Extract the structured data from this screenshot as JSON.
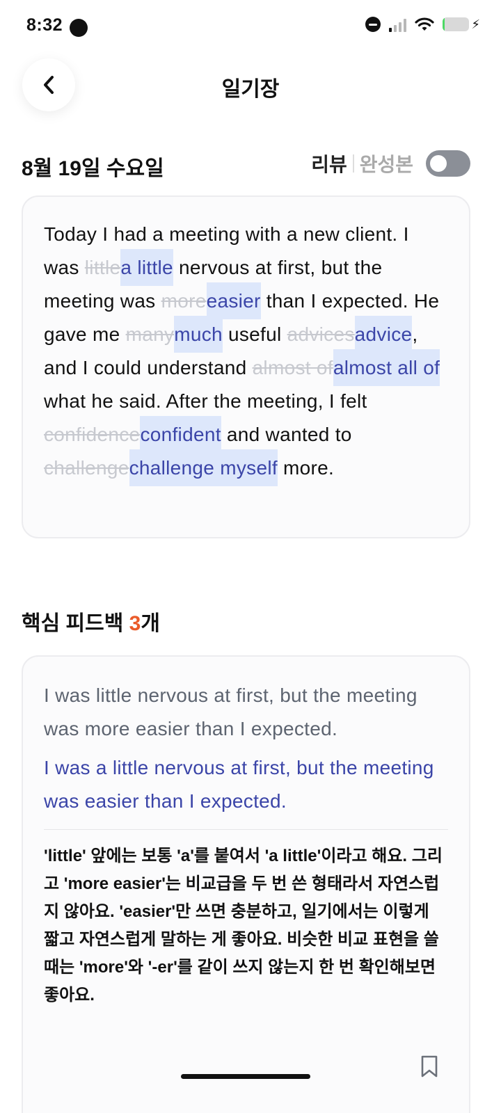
{
  "status_bar": {
    "time": "8:32",
    "icons": [
      "camera-dot",
      "do-not-disturb-icon",
      "signal-icon",
      "wifi-icon",
      "battery-icon",
      "charging-icon"
    ],
    "battery_level": 0.08,
    "battery_color": "#4cd964"
  },
  "header": {
    "back_icon": "chevron-left-icon",
    "title": "일기장"
  },
  "diary": {
    "date": "8월 19일 수요일",
    "mode_review": "리뷰",
    "mode_final": "완성본",
    "toggle_on": false,
    "segments": [
      {
        "t": "Today I had a meeting with a new client. I was "
      },
      {
        "del": "little"
      },
      {
        "ins": "a little"
      },
      {
        "t": " nervous at first, but the meeting was "
      },
      {
        "del": "more"
      },
      {
        "ins": "easier"
      },
      {
        "t": " than I expected. He gave me "
      },
      {
        "del": "many"
      },
      {
        "ins": "much"
      },
      {
        "t": " useful "
      },
      {
        "del": "advices"
      },
      {
        "ins": "advice"
      },
      {
        "t": ", and I could understand "
      },
      {
        "del": "almost of"
      },
      {
        "ins": "almost all of"
      },
      {
        "t": " what he said. After the meeting, I felt "
      },
      {
        "del": "confidence"
      },
      {
        "ins": "confident"
      },
      {
        "t": " and wanted to "
      },
      {
        "del": "challenge"
      },
      {
        "ins": "challenge myself"
      },
      {
        "t": " more."
      }
    ],
    "colors": {
      "inserted_text": "#3b45a8",
      "inserted_bg": "#dde7fb",
      "deleted_text": "#c7c9cf"
    }
  },
  "feedback": {
    "title": "핵심 피드백 ",
    "count": "3",
    "count_suffix": "개",
    "count_color": "#ea5b2a",
    "items": [
      {
        "original": "I was little nervous at first, but the meeting was more easier than I expected.",
        "corrected": "I was a little nervous at first, but the meeting was easier than I expected.",
        "explanation": "'little' 앞에는 보통 'a'를 붙여서 'a little'이라고 해요. 그리고 'more easier'는 비교급을 두 번 쓴 형태라서 자연스럽지 않아요. 'easier'만 쓰면 충분하고, 일기에서는 이렇게 짧고 자연스럽게 말하는 게 좋아요. 비슷한 비교 표현을 쓸 때는 'more'와 '-er'를 같이 쓰지 않는지 한 번 확인해보면 좋아요.",
        "bookmark_icon": "bookmark-icon"
      }
    ]
  }
}
